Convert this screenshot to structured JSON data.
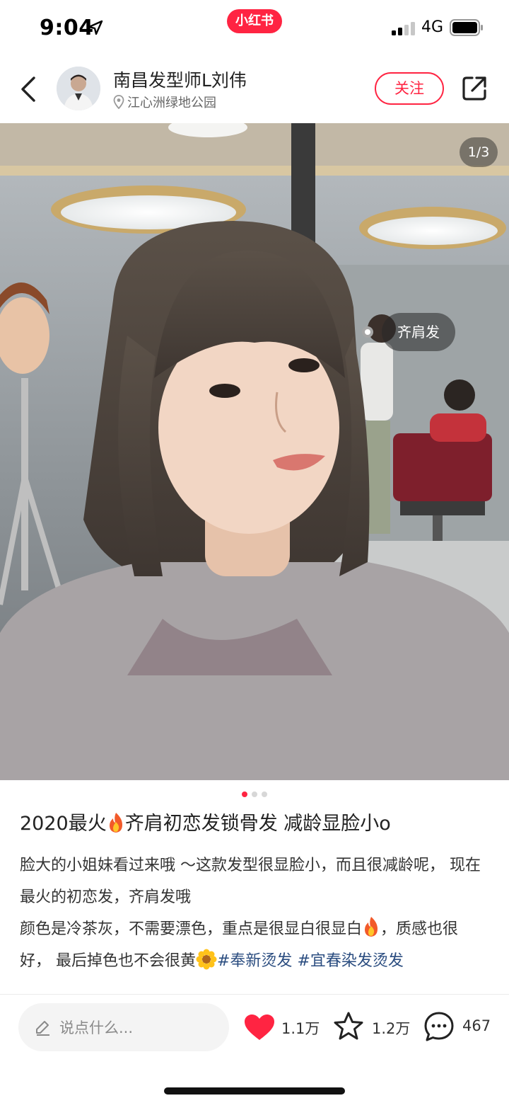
{
  "status_bar": {
    "time": "9:04",
    "app_badge": "小红书",
    "network": "4G"
  },
  "header": {
    "author_name": "南昌发型师L刘伟",
    "location": "江心洲绿地公园",
    "follow_label": "关注"
  },
  "photo": {
    "page_indicator": "1/3",
    "tag_label": "齐肩发",
    "current_page": 1,
    "total_pages": 3
  },
  "note": {
    "title_before_emoji": "2020最火",
    "title_after_emoji": "齐肩初恋发锁骨发 减龄显脸小o",
    "body_line1": "脸大的小姐妹看过来哦 ～这款发型很显脸小，而且很减龄呢，  现在最火的初恋发，齐肩发哦",
    "body_line2_before_emoji": "颜色是冷茶灰，不需要漂色，重点是很显白很显白",
    "body_line2_after_emoji": "，质感也很好，  最后掉色也不会很黄",
    "hashtag1": "#奉新烫发",
    "hashtag2": "#宜春染发烫发"
  },
  "bottom_bar": {
    "comment_placeholder": "说点什么...",
    "like_count": "1.1万",
    "collect_count": "1.2万",
    "comment_count": "467"
  },
  "colors": {
    "brand_red": "#ff2442",
    "hashtag_blue": "#2b4d80"
  },
  "icons": [
    "location-arrow-icon",
    "signal-icon",
    "battery-icon",
    "back-icon",
    "pin-icon",
    "share-icon",
    "fire-emoji-icon",
    "sunflower-emoji-icon",
    "pencil-icon",
    "heart-icon",
    "star-icon",
    "comment-bubble-icon"
  ]
}
